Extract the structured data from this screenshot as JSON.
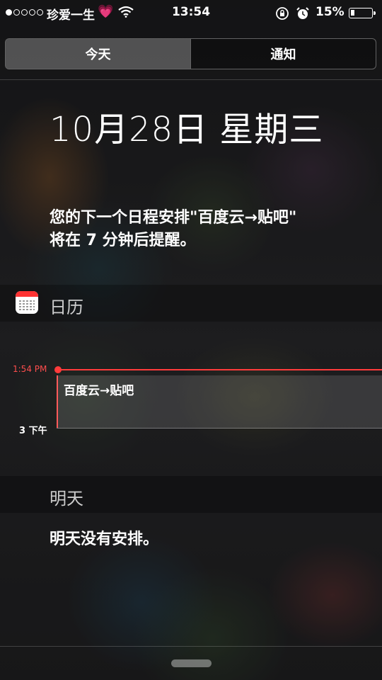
{
  "status_bar": {
    "carrier": "珍爱一生",
    "time": "13:54",
    "battery_percent": "15%",
    "signal_bars": 1,
    "signal_total": 5,
    "battery_level": 0.15
  },
  "tabs": [
    {
      "label": "今天",
      "active": true
    },
    {
      "label": "通知",
      "active": false
    }
  ],
  "today": {
    "date": "10月28日  星期三",
    "summary_line1": "您的下一个日程安排\"百度云→贴吧\"",
    "summary_line2": "将在 7 分钟后提醒。"
  },
  "calendar": {
    "section_title": "日历",
    "now_time": "1:54 PM",
    "events": [
      {
        "title": "百度云→贴吧"
      }
    ],
    "hour_label": "3 下午"
  },
  "tomorrow": {
    "section_title": "明天",
    "message": "明天没有安排。"
  },
  "colors": {
    "now_indicator": "#ff3b3b",
    "calendar_icon_red": "#ff3333"
  }
}
